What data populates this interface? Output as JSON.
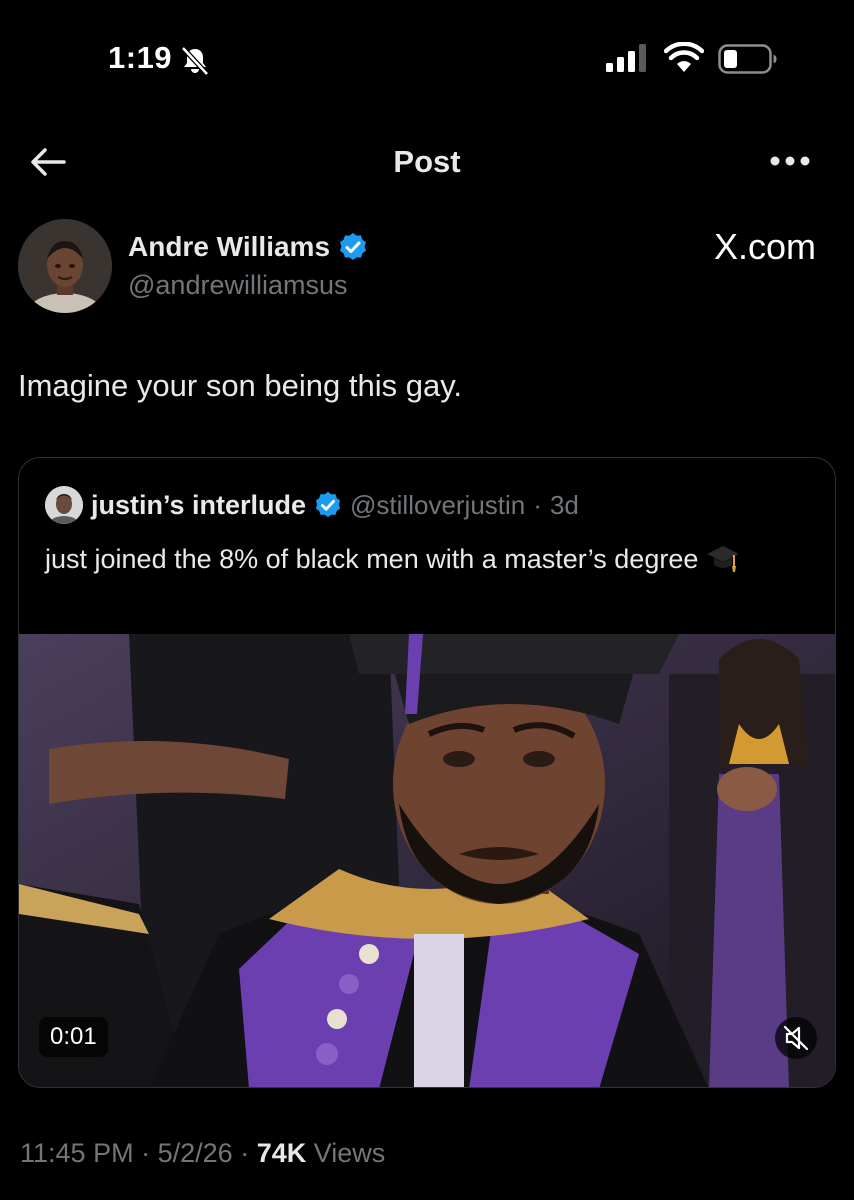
{
  "status_bar": {
    "time": "1:19",
    "icons": [
      "bell-slash-icon",
      "signal-icon",
      "wifi-icon",
      "battery-icon"
    ]
  },
  "header": {
    "title": "Post",
    "back_icon": "arrow-left-icon",
    "more_icon": "more-horizontal-icon"
  },
  "post": {
    "author_name": "Andre Williams",
    "author_handle": "@andrewilliamsus",
    "watermark": "X.com",
    "text": "Imagine your son being this gay.",
    "quote": {
      "author_name": "justin’s interlude",
      "author_handle": "@stilloverjustin",
      "separator": "·",
      "age": "3d",
      "text": "just joined the 8% of black men with a master’s degree",
      "emoji": "graduation-cap-icon",
      "video_time": "0:01"
    },
    "time": "11:45 PM",
    "date": "5/2/26",
    "sep": "·",
    "views_count": "74K",
    "views_label": "Views"
  },
  "colors": {
    "background": "#000000",
    "text": "#e7e9ea",
    "secondary": "#71767b",
    "verified": "#1d9bf0",
    "border": "#2f3336"
  }
}
